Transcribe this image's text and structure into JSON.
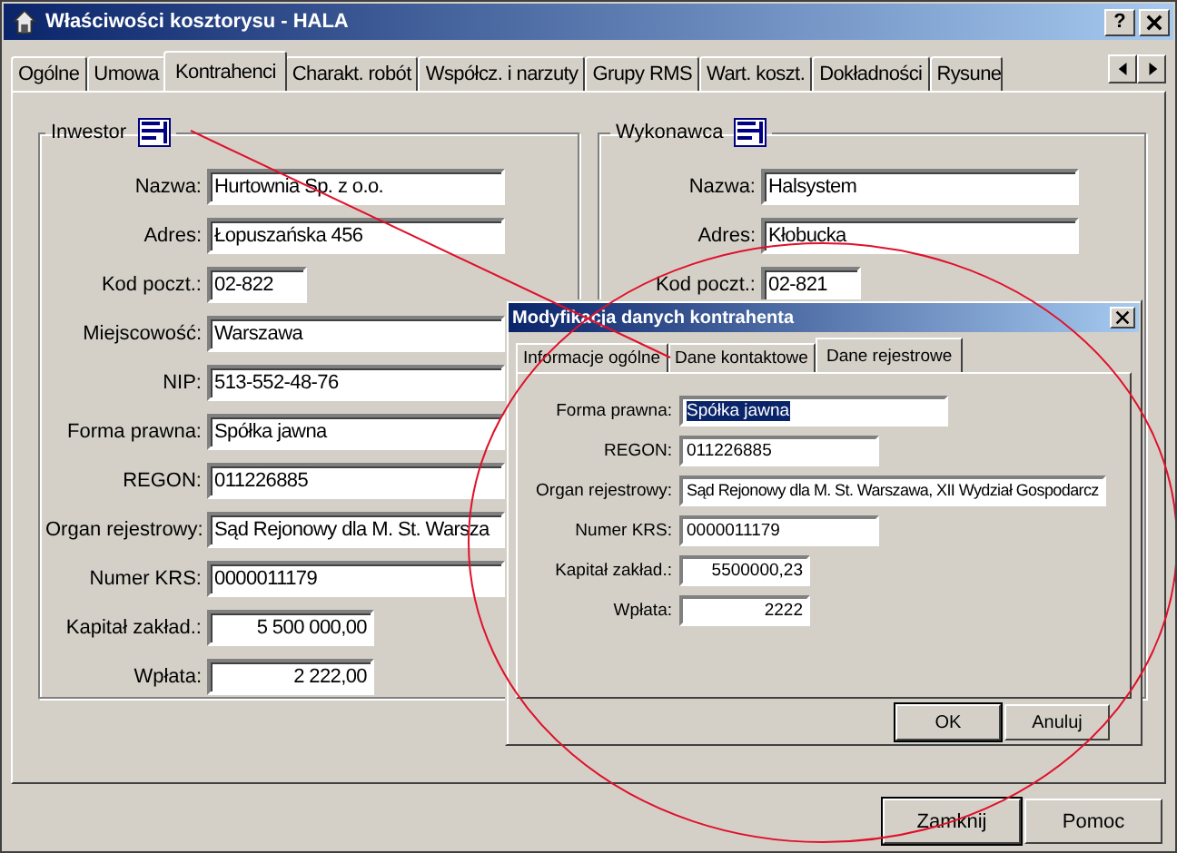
{
  "window": {
    "title": "Właściwości kosztorysu - HALA",
    "help": "?"
  },
  "tabs": [
    {
      "label": "Ogólne",
      "selected": false
    },
    {
      "label": "Umowa",
      "selected": false
    },
    {
      "label": "Kontrahenci",
      "selected": true
    },
    {
      "label": "Charakt. robót",
      "selected": false
    },
    {
      "label": "Współcz. i narzuty",
      "selected": false
    },
    {
      "label": "Grupy RMS",
      "selected": false
    },
    {
      "label": "Wart. koszt.",
      "selected": false
    },
    {
      "label": "Dokładności",
      "selected": false
    },
    {
      "label": "Rysune",
      "selected": false
    }
  ],
  "groups": [
    {
      "title": "Inwestor",
      "fields": [
        {
          "label": "Nazwa:",
          "value": "Hurtownia Sp. z o.o.",
          "kind": "text"
        },
        {
          "label": "Adres:",
          "value": "Łopuszańska 456",
          "kind": "text"
        },
        {
          "label": "Kod poczt.:",
          "value": "02-822",
          "kind": "short"
        },
        {
          "label": "Miejscowość:",
          "value": "Warszawa",
          "kind": "text"
        },
        {
          "label": "NIP:",
          "value": "513-552-48-76",
          "kind": "text"
        },
        {
          "label": "Forma prawna:",
          "value": "Spółka jawna",
          "kind": "text"
        },
        {
          "label": "REGON:",
          "value": "011226885",
          "kind": "text"
        },
        {
          "label": "Organ rejestrowy:",
          "value": "Sąd Rejonowy dla M. St. Warsza",
          "kind": "text"
        },
        {
          "label": "Numer KRS:",
          "value": "0000011179",
          "kind": "text"
        },
        {
          "label": "Kapitał zakład.:",
          "value": "5 500 000,00",
          "kind": "amount"
        },
        {
          "label": "Wpłata:",
          "value": "2 222,00",
          "kind": "amount"
        }
      ]
    },
    {
      "title": "Wykonawca",
      "fields": [
        {
          "label": "Nazwa:",
          "value": "Halsystem",
          "kind": "text"
        },
        {
          "label": "Adres:",
          "value": "Kłobucka",
          "kind": "text"
        },
        {
          "label": "Kod poczt.:",
          "value": "02-821",
          "kind": "short"
        }
      ]
    }
  ],
  "dialog": {
    "title": "Modyfikacja danych kontrahenta",
    "tabs": [
      {
        "label": "Informacje ogólne",
        "selected": false
      },
      {
        "label": "Dane kontaktowe",
        "selected": false
      },
      {
        "label": "Dane rejestrowe",
        "selected": true
      }
    ],
    "fields": [
      {
        "label": "Forma prawna:",
        "value": "Spółka jawna",
        "kind": "text",
        "selected": true
      },
      {
        "label": "REGON:",
        "value": "011226885",
        "kind": "mid",
        "selected": false
      },
      {
        "label": "Organ rejestrowy:",
        "value": "Sąd Rejonowy dla M. St. Warszawa, XII Wydział Gospodarcz",
        "kind": "long",
        "selected": false
      },
      {
        "label": "Numer KRS:",
        "value": "0000011179",
        "kind": "mid",
        "selected": false
      },
      {
        "label": "Kapitał zakład.:",
        "value": "5500000,23",
        "kind": "amount",
        "selected": false
      },
      {
        "label": "Wpłata:",
        "value": "2222",
        "kind": "amount",
        "selected": false
      }
    ],
    "buttons": [
      "OK",
      "Anuluj"
    ]
  },
  "buttons": [
    "Zamknij",
    "Pomoc"
  ]
}
